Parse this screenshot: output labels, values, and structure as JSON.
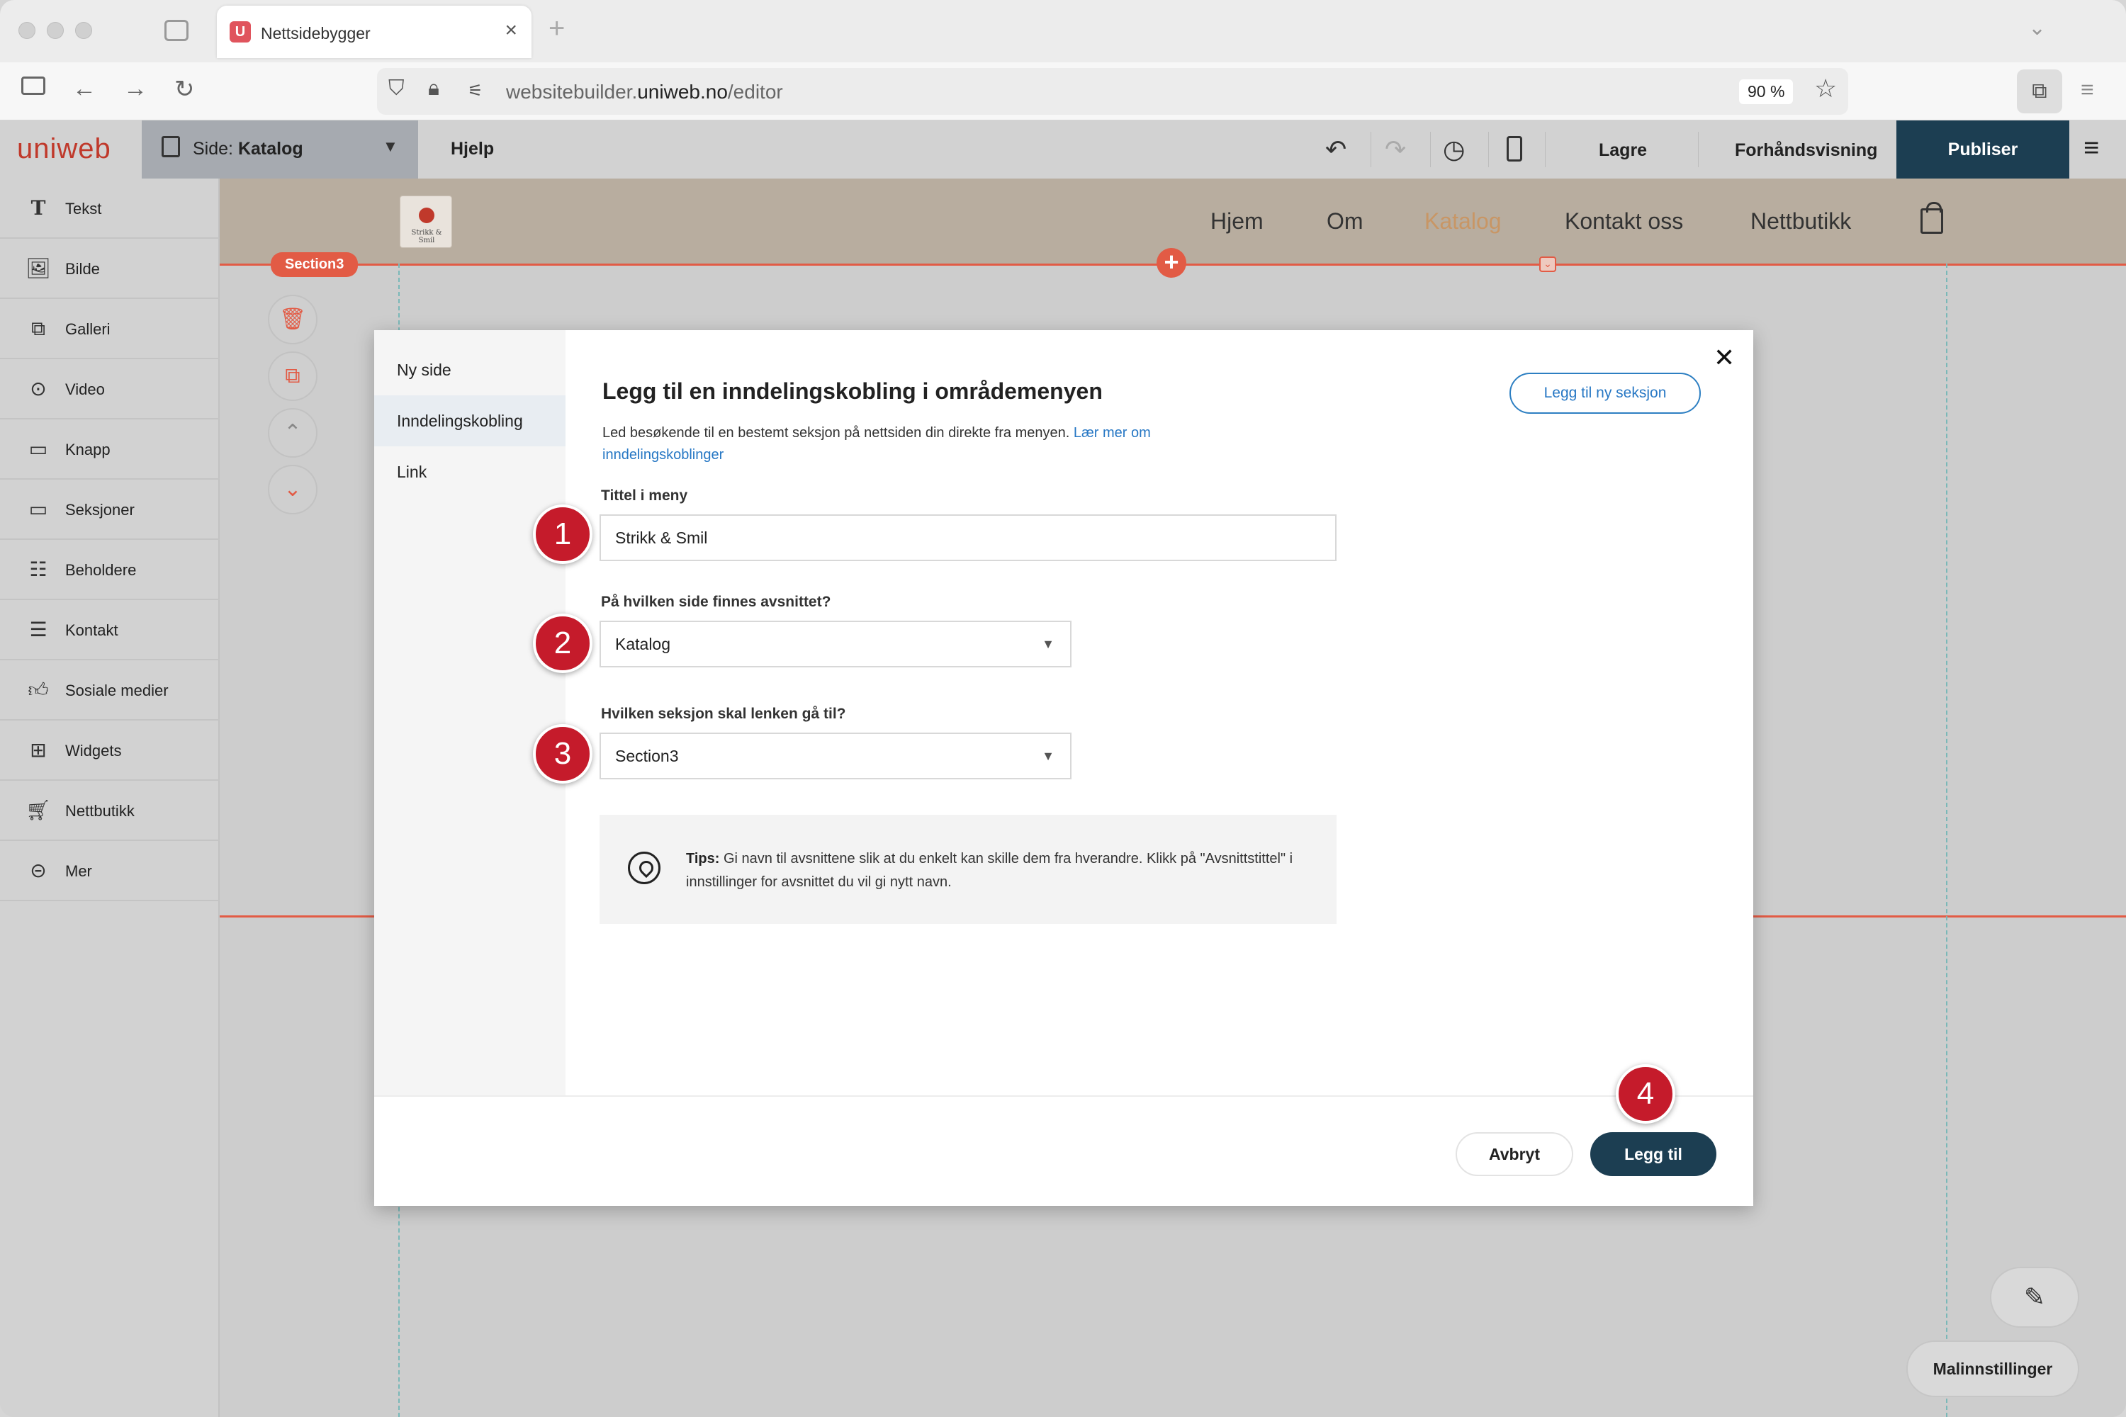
{
  "browser": {
    "tab_title": "Nettsidebygger",
    "tab_favicon": "U",
    "url_host": "websitebuilder.",
    "url_domain": "uniweb.no",
    "url_path": "/editor",
    "zoom": "90 %"
  },
  "editor": {
    "logo": "uniweb",
    "page_select_prefix": "Side: ",
    "page_select_value": "Katalog",
    "help": "Hjelp",
    "save": "Lagre",
    "preview": "Forhåndsvisning",
    "publish": "Publiser"
  },
  "sidebar": {
    "items": [
      {
        "label": "Tekst",
        "icon": "text-icon"
      },
      {
        "label": "Bilde",
        "icon": "image-icon"
      },
      {
        "label": "Galleri",
        "icon": "gallery-icon"
      },
      {
        "label": "Video",
        "icon": "video-icon"
      },
      {
        "label": "Knapp",
        "icon": "button-icon"
      },
      {
        "label": "Seksjoner",
        "icon": "sections-icon"
      },
      {
        "label": "Beholdere",
        "icon": "containers-icon"
      },
      {
        "label": "Kontakt",
        "icon": "contact-icon"
      },
      {
        "label": "Sosiale medier",
        "icon": "thumbs-up-icon"
      },
      {
        "label": "Widgets",
        "icon": "widgets-icon"
      },
      {
        "label": "Nettbutikk",
        "icon": "cart-icon"
      },
      {
        "label": "Mer",
        "icon": "more-icon"
      }
    ]
  },
  "site": {
    "logo_text": "Strikk & Smil",
    "nav": [
      "Hjem",
      "Om",
      "Katalog",
      "Kontakt oss",
      "Nettbutikk"
    ],
    "active_nav": "Katalog",
    "section_tag": "Section3",
    "accent_color": "#e25b45"
  },
  "modal": {
    "nav": [
      "Ny side",
      "Inndelingskobling",
      "Link"
    ],
    "active_nav": "Inndelingskobling",
    "title": "Legg til en inndelingskobling i områdemenyen",
    "description": "Led besøkende til en bestemt seksjon på nettsiden din direkte fra menyen.",
    "learn_more": "Lær mer om inndelingskoblinger",
    "add_new_section": "Legg til ny seksjon",
    "fields": {
      "menu_title_label": "Tittel i meny",
      "menu_title_value": "Strikk & Smil",
      "page_label": "På hvilken side finnes avsnittet?",
      "page_value": "Katalog",
      "section_label": "Hvilken seksjon skal lenken gå til?",
      "section_value": "Section3"
    },
    "tips_label": "Tips:",
    "tips_text": "Gi navn til avsnittene slik at du enkelt kan skille dem fra hverandre. Klikk på \"Avsnittstittel\" i innstillinger for avsnittet du vil gi nytt navn.",
    "cancel": "Avbryt",
    "add": "Legg til"
  },
  "badges": [
    "1",
    "2",
    "3",
    "4"
  ],
  "theme_settings": "Malinnstillinger",
  "colors": {
    "brand_dark": "#1c3e52",
    "badge_red": "#c51b2b",
    "link_blue": "#2677c4"
  }
}
